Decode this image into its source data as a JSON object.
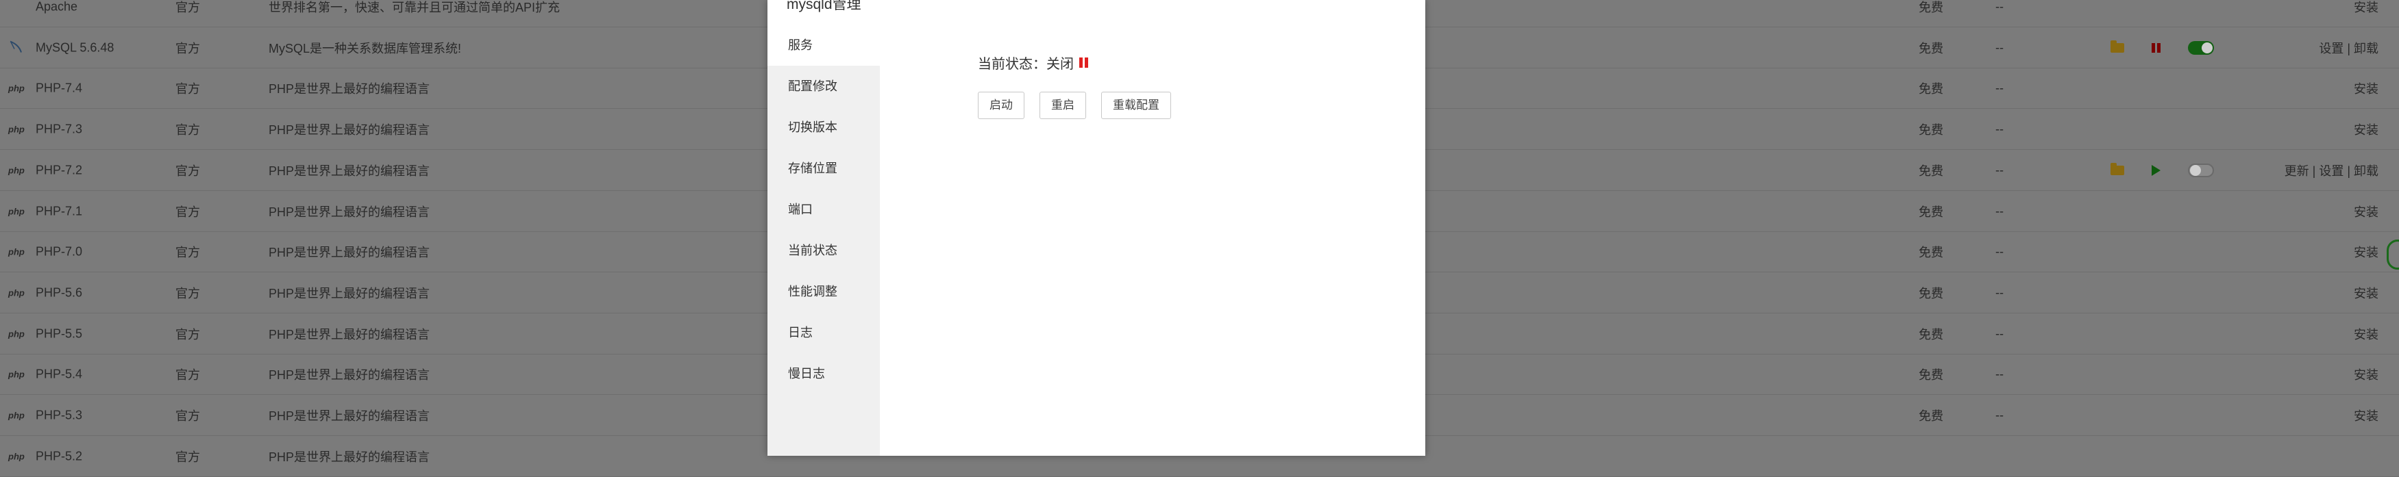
{
  "plugins": [
    {
      "icon": "",
      "name": "Apache",
      "type": "官方",
      "desc": "世界排名第一，快速、可靠并且可通过简单的API扩充",
      "price": "免费",
      "expire": "--",
      "ops": [],
      "actions": "安装"
    },
    {
      "icon": "feather-icon",
      "name": "MySQL 5.6.48",
      "type": "官方",
      "desc": "MySQL是一种关系数据库管理系统!",
      "price": "免费",
      "expire": "--",
      "ops": [
        "folder",
        "pause",
        "toggle-on"
      ],
      "actions": "设置 | 卸载"
    },
    {
      "icon": "php",
      "name": "PHP-7.4",
      "type": "官方",
      "desc": "PHP是世界上最好的编程语言",
      "price": "免费",
      "expire": "--",
      "ops": [],
      "actions": "安装"
    },
    {
      "icon": "php",
      "name": "PHP-7.3",
      "type": "官方",
      "desc": "PHP是世界上最好的编程语言",
      "price": "免费",
      "expire": "--",
      "ops": [],
      "actions": "安装"
    },
    {
      "icon": "php",
      "name": "PHP-7.2",
      "type": "官方",
      "desc": "PHP是世界上最好的编程语言",
      "price": "免费",
      "expire": "--",
      "ops": [
        "folder",
        "play",
        "toggle-off"
      ],
      "actions": "更新 | 设置 | 卸载"
    },
    {
      "icon": "php",
      "name": "PHP-7.1",
      "type": "官方",
      "desc": "PHP是世界上最好的编程语言",
      "price": "免费",
      "expire": "--",
      "ops": [],
      "actions": "安装"
    },
    {
      "icon": "php",
      "name": "PHP-7.0",
      "type": "官方",
      "desc": "PHP是世界上最好的编程语言",
      "price": "免费",
      "expire": "--",
      "ops": [],
      "actions": "安装"
    },
    {
      "icon": "php",
      "name": "PHP-5.6",
      "type": "官方",
      "desc": "PHP是世界上最好的编程语言",
      "price": "免费",
      "expire": "--",
      "ops": [],
      "actions": "安装"
    },
    {
      "icon": "php",
      "name": "PHP-5.5",
      "type": "官方",
      "desc": "PHP是世界上最好的编程语言",
      "price": "免费",
      "expire": "--",
      "ops": [],
      "actions": "安装"
    },
    {
      "icon": "php",
      "name": "PHP-5.4",
      "type": "官方",
      "desc": "PHP是世界上最好的编程语言",
      "price": "免费",
      "expire": "--",
      "ops": [],
      "actions": "安装"
    },
    {
      "icon": "php",
      "name": "PHP-5.3",
      "type": "官方",
      "desc": "PHP是世界上最好的编程语言",
      "price": "免费",
      "expire": "--",
      "ops": [],
      "actions": "安装"
    },
    {
      "icon": "php",
      "name": "PHP-5.2",
      "type": "官方",
      "desc": "PHP是世界上最好的编程语言",
      "price": "",
      "expire": "",
      "ops": [],
      "actions": ""
    }
  ],
  "modal": {
    "title": "mysqld管理",
    "nav": [
      "服务",
      "配置修改",
      "切换版本",
      "存储位置",
      "端口",
      "当前状态",
      "性能调整",
      "日志",
      "慢日志"
    ],
    "active_index": 0,
    "status_label": "当前状态：",
    "status_value": "关闭",
    "buttons": {
      "start": "启动",
      "restart": "重启",
      "reload": "重载配置"
    }
  },
  "colors": {
    "overlay_bg": "#7b7b7b",
    "action_green": "#1b5e1b",
    "status_red": "#e02020",
    "modal_nav_bg": "#f0f0f0"
  }
}
